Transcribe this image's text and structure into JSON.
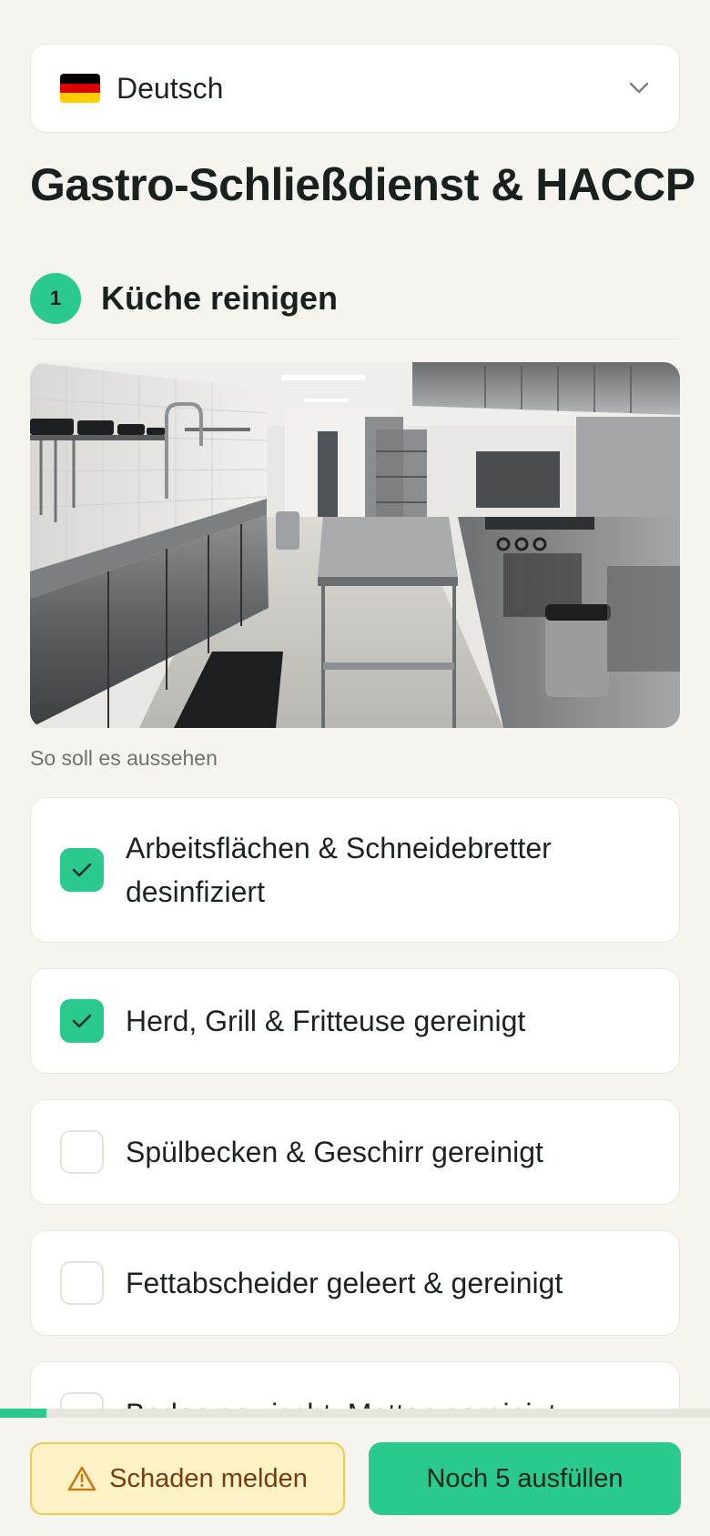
{
  "language": {
    "label": "Deutsch",
    "flag_colors": [
      "#000000",
      "#dd0000",
      "#ffce00"
    ],
    "icon": "chevron-down-icon"
  },
  "page_title": "Gastro-Schließdienst & HACCP",
  "step": {
    "number": "1",
    "title": "Küche reinigen"
  },
  "photo": {
    "caption": "So soll es aussehen"
  },
  "checklist": [
    {
      "label": "Arbeitsflächen & Schneidebretter desinfiziert",
      "checked": true
    },
    {
      "label": "Herd, Grill & Fritteuse gereinigt",
      "checked": true
    },
    {
      "label": "Spülbecken & Geschirr gereinigt",
      "checked": false
    },
    {
      "label": "Fettabscheider geleert & gereinigt",
      "checked": false
    },
    {
      "label": "Boden gewischt, Matten gereinigt",
      "checked": false
    }
  ],
  "progress": {
    "fraction": 0.065
  },
  "footer": {
    "report_label": "Schaden melden",
    "report_icon": "warning-icon",
    "submit_label": "Noch 5 ausfüllen"
  },
  "colors": {
    "accent": "#2ac98e",
    "warning_bg": "#fdf2c6",
    "warning_border": "#f2c94c",
    "warning_text": "#7a3b0e",
    "background": "#f5f4ef"
  }
}
